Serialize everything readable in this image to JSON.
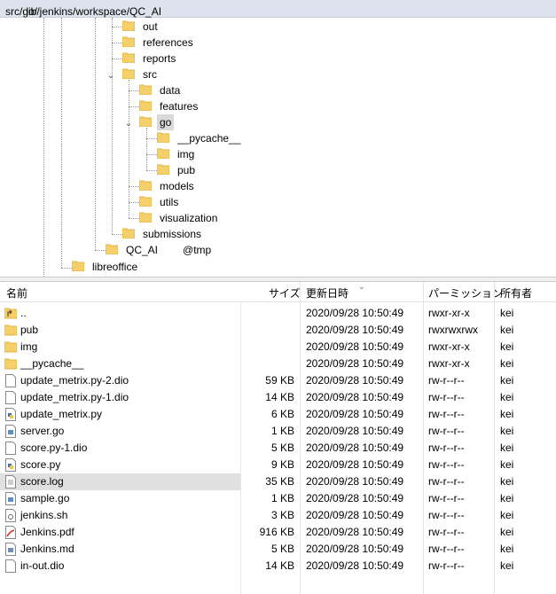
{
  "path": {
    "before": "/var/lib/jenkins/workspace/QC_AI",
    "after": "src/go/"
  },
  "tree": {
    "out": "out",
    "references": "references",
    "reports": "reports",
    "src": "src",
    "data": "data",
    "features": "features",
    "go": "go",
    "pycache": "__pycache__",
    "img": "img",
    "pub": "pub",
    "models": "models",
    "utils": "utils",
    "visualization": "visualization",
    "submissions": "submissions",
    "qc_tmp_a": "QC_AI",
    "qc_tmp_b": "@tmp",
    "libreoffice": "libreoffice"
  },
  "columns": {
    "name": "名前",
    "size": "サイズ",
    "modified": "更新日時",
    "perm": "パーミッション",
    "owner": "所有者"
  },
  "files": [
    {
      "name": "..",
      "size": "",
      "modified": "2020/09/28 10:50:49",
      "perm": "rwxr-xr-x",
      "owner": "kei",
      "icon": "parent-folder-icon"
    },
    {
      "name": "pub",
      "size": "",
      "modified": "2020/09/28 10:50:49",
      "perm": "rwxrwxrwx",
      "owner": "kei",
      "icon": "folder-icon"
    },
    {
      "name": "img",
      "size": "",
      "modified": "2020/09/28 10:50:49",
      "perm": "rwxr-xr-x",
      "owner": "kei",
      "icon": "folder-icon"
    },
    {
      "name": "__pycache__",
      "size": "",
      "modified": "2020/09/28 10:50:49",
      "perm": "rwxr-xr-x",
      "owner": "kei",
      "icon": "folder-icon"
    },
    {
      "name": "update_metrix.py-2.dio",
      "size": "59 KB",
      "modified": "2020/09/28 10:50:49",
      "perm": "rw-r--r--",
      "owner": "kei",
      "icon": "file-icon"
    },
    {
      "name": "update_metrix.py-1.dio",
      "size": "14 KB",
      "modified": "2020/09/28 10:50:49",
      "perm": "rw-r--r--",
      "owner": "kei",
      "icon": "file-icon"
    },
    {
      "name": "update_metrix.py",
      "size": "6 KB",
      "modified": "2020/09/28 10:50:49",
      "perm": "rw-r--r--",
      "owner": "kei",
      "icon": "python-file-icon"
    },
    {
      "name": "server.go",
      "size": "1 KB",
      "modified": "2020/09/28 10:50:49",
      "perm": "rw-r--r--",
      "owner": "kei",
      "icon": "go-file-icon"
    },
    {
      "name": "score.py-1.dio",
      "size": "5 KB",
      "modified": "2020/09/28 10:50:49",
      "perm": "rw-r--r--",
      "owner": "kei",
      "icon": "file-icon"
    },
    {
      "name": "score.py",
      "size": "9 KB",
      "modified": "2020/09/28 10:50:49",
      "perm": "rw-r--r--",
      "owner": "kei",
      "icon": "python-file-icon"
    },
    {
      "name": "score.log",
      "size": "35 KB",
      "modified": "2020/09/28 10:50:49",
      "perm": "rw-r--r--",
      "owner": "kei",
      "icon": "log-file-icon"
    },
    {
      "name": "sample.go",
      "size": "1 KB",
      "modified": "2020/09/28 10:50:49",
      "perm": "rw-r--r--",
      "owner": "kei",
      "icon": "go-file-icon"
    },
    {
      "name": "jenkins.sh",
      "size": "3 KB",
      "modified": "2020/09/28 10:50:49",
      "perm": "rw-r--r--",
      "owner": "kei",
      "icon": "shell-file-icon"
    },
    {
      "name": "Jenkins.pdf",
      "size": "916 KB",
      "modified": "2020/09/28 10:50:49",
      "perm": "rw-r--r--",
      "owner": "kei",
      "icon": "pdf-file-icon"
    },
    {
      "name": "Jenkins.md",
      "size": "5 KB",
      "modified": "2020/09/28 10:50:49",
      "perm": "rw-r--r--",
      "owner": "kei",
      "icon": "markdown-file-icon"
    },
    {
      "name": "in-out.dio",
      "size": "14 KB",
      "modified": "2020/09/28 10:50:49",
      "perm": "rw-r--r--",
      "owner": "kei",
      "icon": "file-icon"
    }
  ],
  "colors": {
    "folder": "#f5cf6a",
    "folder_dark": "#e0b445",
    "selected": "#e0e0e0",
    "pathbar": "#dde3ec"
  }
}
